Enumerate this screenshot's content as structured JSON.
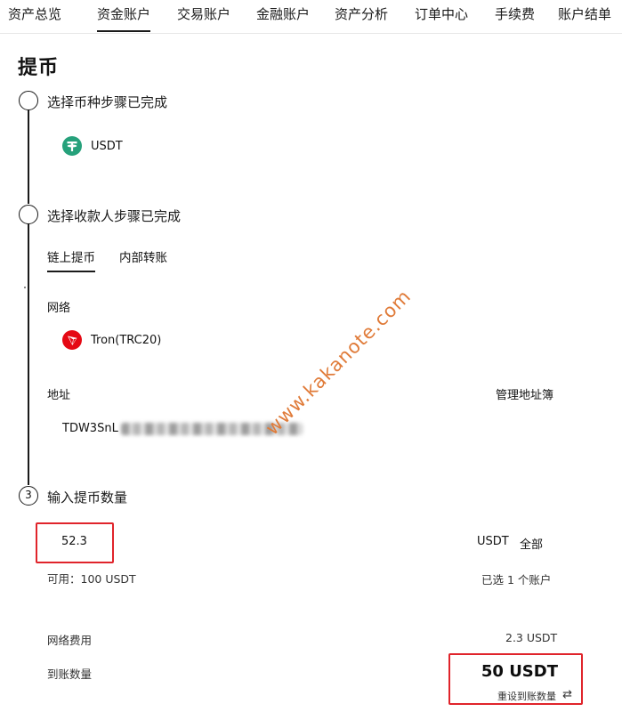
{
  "nav": {
    "tabs": [
      "资产总览",
      "资金账户",
      "交易账户",
      "金融账户",
      "资产分析",
      "订单中心",
      "手续费",
      "账户结单"
    ],
    "active_index": 1
  },
  "page": {
    "title": "提币"
  },
  "steps": [
    {
      "marker": "",
      "title": "选择币种步骤已完成"
    },
    {
      "marker": "",
      "title": "选择收款人步骤已完成"
    },
    {
      "marker": "3",
      "title": "输入提币数量"
    }
  ],
  "coin": {
    "icon": "tether-icon",
    "label": "USDT",
    "color": "#26a17b"
  },
  "withdraw_tabs": {
    "onchain": "链上提币",
    "internal": "内部转账"
  },
  "network": {
    "label": "网络",
    "icon": "tron-icon",
    "value": "Tron(TRC20)",
    "color": "#e50914"
  },
  "address": {
    "label": "地址",
    "manage_link": "管理地址簿",
    "value_prefix": "TDW3SnL"
  },
  "amount": {
    "value": "52.3",
    "unit": "USDT",
    "all_link": "全部",
    "available": "可用：100 USDT",
    "accounts_selected": "已选 1 个账户"
  },
  "fee": {
    "label": "网络费用",
    "value": "2.3 USDT"
  },
  "receive": {
    "label": "到账数量",
    "value": "50 USDT",
    "reset_link": "重设到账数量"
  },
  "watermark": "www.kakanote.com",
  "colors": {
    "highlight": "#e0242b",
    "text": "#121212",
    "watermark": "#e07b39"
  }
}
